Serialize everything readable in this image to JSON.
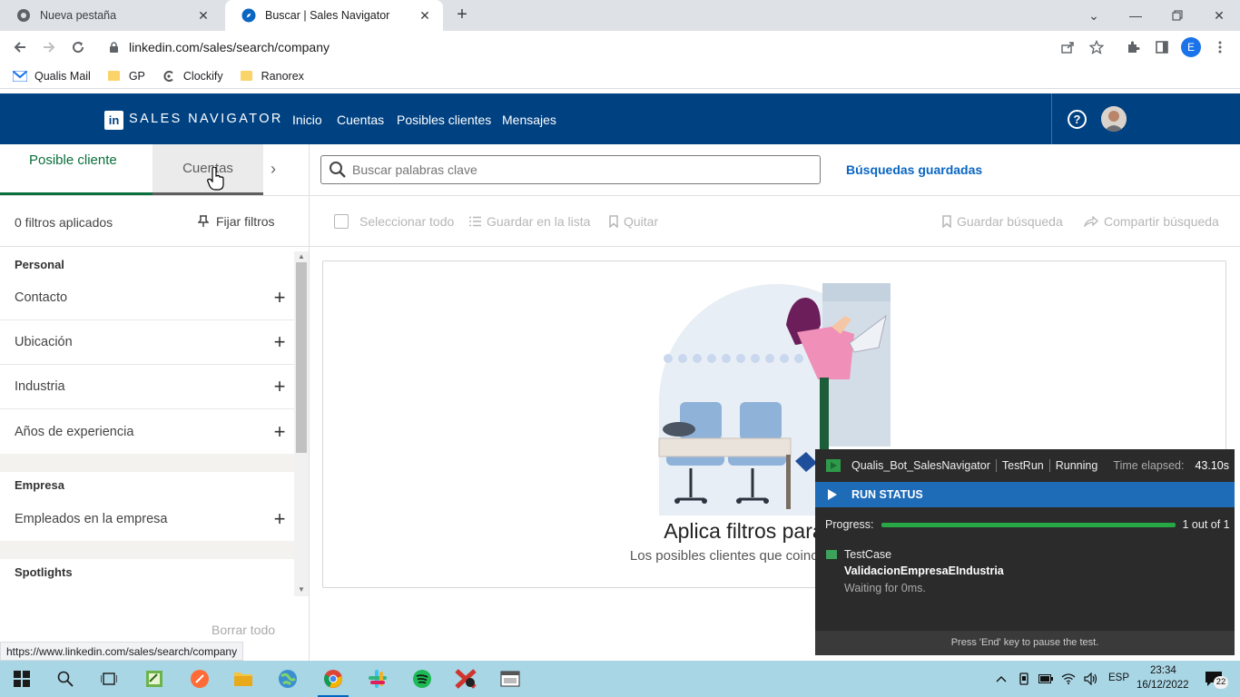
{
  "browser": {
    "tabs": [
      {
        "title": "Nueva pestaña",
        "icon": "chrome-newtab-icon",
        "active": false
      },
      {
        "title": "Buscar | Sales Navigator",
        "icon": "sales-navigator-compass-icon",
        "active": true
      }
    ],
    "url": "linkedin.com/sales/search/company",
    "bookmarks": [
      {
        "label": "Qualis Mail",
        "icon": "gmail-icon"
      },
      {
        "label": "GP",
        "icon": "folder-icon"
      },
      {
        "label": "Clockify",
        "icon": "clockify-icon"
      },
      {
        "label": "Ranorex",
        "icon": "folder-icon"
      }
    ],
    "profile_initial": "E",
    "status_url": "https://www.linkedin.com/sales/search/company"
  },
  "header": {
    "logo_text": "in",
    "brand": "SALES NAVIGATOR",
    "nav": [
      "Inicio",
      "Cuentas",
      "Posibles clientes",
      "Mensajes"
    ],
    "help_symbol": "?"
  },
  "left": {
    "tabs": {
      "leads": "Posible cliente",
      "accounts": "Cuentas"
    },
    "filters_count": "0 filtros aplicados",
    "pin_filters": "Fijar filtros",
    "sections": [
      {
        "title": "Personal",
        "items": [
          "Contacto",
          "Ubicación",
          "Industria",
          "Años de experiencia"
        ]
      },
      {
        "title": "Empresa",
        "items": [
          "Empleados en la empresa"
        ]
      },
      {
        "title": "Spotlights",
        "items": []
      }
    ],
    "clear_all": "Borrar todo"
  },
  "main": {
    "search_placeholder": "Buscar palabras clave",
    "saved_searches": "Búsquedas guardadas",
    "actions": {
      "select_all": "Seleccionar todo",
      "save_to_list": "Guardar en la lista",
      "remove": "Quitar",
      "save_search": "Guardar búsqueda",
      "share_search": "Compartir búsqueda"
    },
    "empty_title": "Aplica filtros para encon",
    "empty_subtitle": "Los posibles clientes que coincidan con tus crite"
  },
  "ranorex": {
    "bot": "Qualis_Bot_SalesNavigator",
    "mode": "TestRun",
    "state": "Running",
    "elapsed_label": "Time elapsed:",
    "elapsed_value": "43.10s",
    "run_status": "RUN STATUS",
    "progress_label": "Progress:",
    "progress_fraction": 1.0,
    "progress_text": "1 out of 1",
    "testcase_label": "TestCase",
    "testcase_name": "ValidacionEmpresaEIndustria",
    "waiting": "Waiting for 0ms.",
    "footer": "Press 'End' key to pause the test."
  },
  "taskbar": {
    "lang": "ESP",
    "time": "23:34",
    "date": "16/12/2022",
    "notifications": "22"
  },
  "colors": {
    "linkedin_header": "#004182",
    "accent_blue": "#0a66c2",
    "lead_tab_green": "#0a6f3c",
    "ranorex_bg": "#2b2b2b",
    "ranorex_status": "#1e6bb8",
    "progress_green": "#28a745",
    "taskbar": "#a9d6e5"
  }
}
